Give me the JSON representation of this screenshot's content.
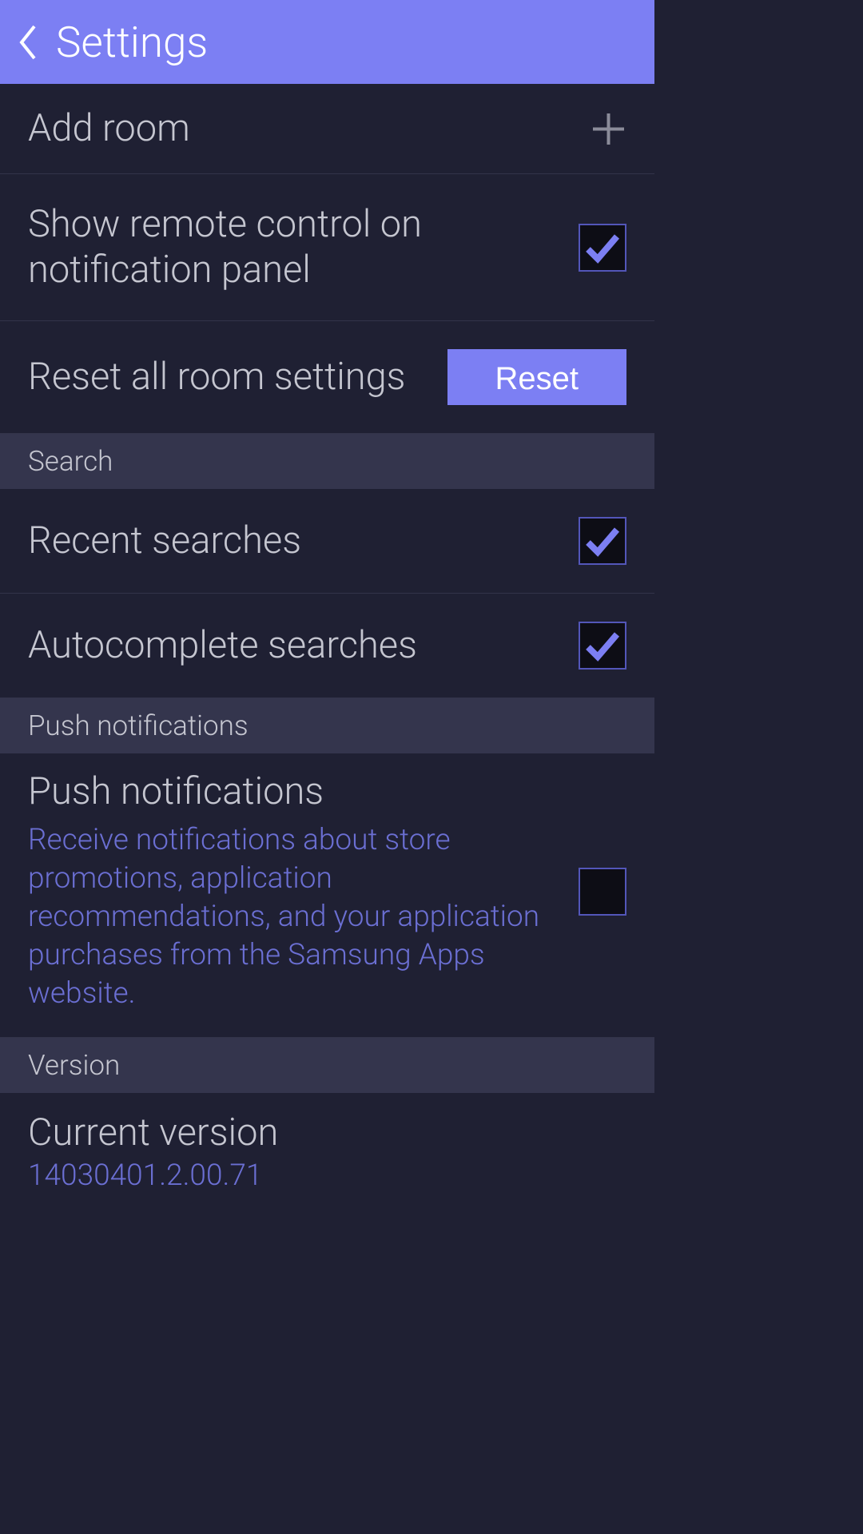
{
  "header": {
    "title": "Settings"
  },
  "rooms": {
    "add_room_label": "Add room",
    "show_remote_label": "Show remote control on notification panel",
    "show_remote_checked": true,
    "reset_label": "Reset all room settings",
    "reset_button": "Reset"
  },
  "search": {
    "section_title": "Search",
    "recent_label": "Recent searches",
    "recent_checked": true,
    "autocomplete_label": "Autocomplete searches",
    "autocomplete_checked": true
  },
  "push": {
    "section_title": "Push notifications",
    "label": "Push notifications",
    "description": "Receive notifications about store promotions, application recommendations, and your application purchases from the Samsung Apps website.",
    "checked": false
  },
  "version": {
    "section_title": "Version",
    "label": "Current version",
    "value": "14030401.2.00.71"
  }
}
